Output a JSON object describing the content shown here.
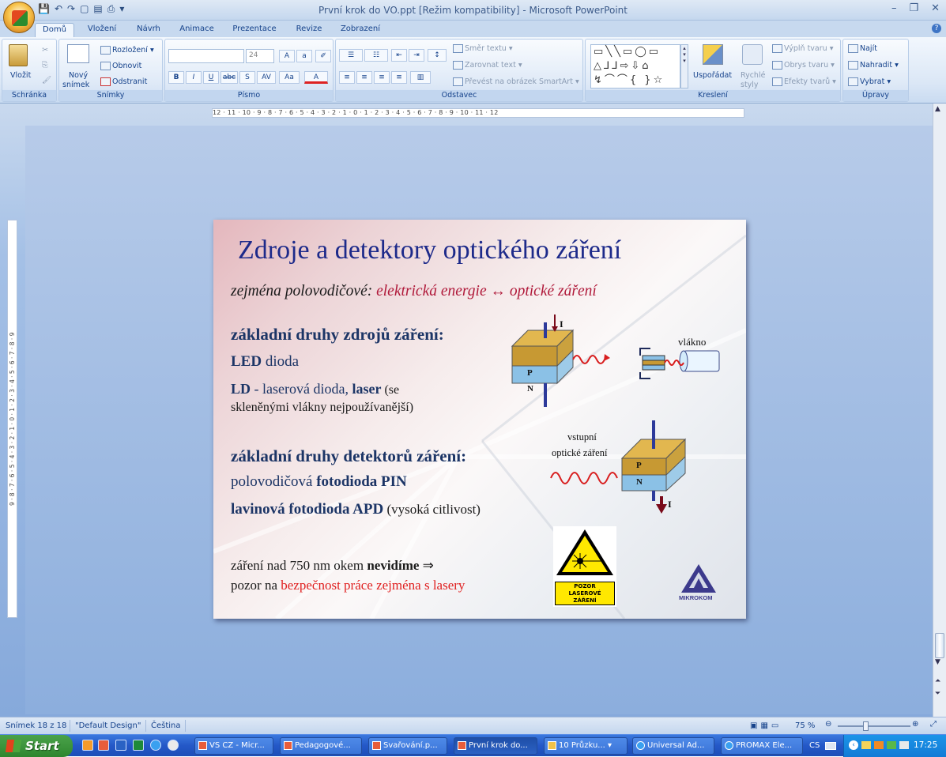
{
  "window": {
    "title": "První krok do VO.ppt [Režim kompatibility] - Microsoft PowerPoint"
  },
  "tabs": [
    "Domů",
    "Vložení",
    "Návrh",
    "Animace",
    "Prezentace",
    "Revize",
    "Zobrazení"
  ],
  "ribbon": {
    "schranka": {
      "label": "Schránka",
      "paste": "Vložit"
    },
    "snimky": {
      "label": "Snímky",
      "new_slide": "Nový",
      "new_slide2": "snímek",
      "layout": "Rozložení",
      "reset": "Obnovit",
      "delete": "Odstranit"
    },
    "pismo": {
      "label": "Písmo",
      "font_size": "24"
    },
    "odstavec": {
      "label": "Odstavec",
      "text_direction": "Směr textu",
      "align_text": "Zarovnat text",
      "smartart": "Převést na obrázek SmartArt"
    },
    "kresleni": {
      "label": "Kreslení",
      "arrange": "Uspořádat",
      "quick_styles": "Rychlé",
      "quick_styles2": "styly",
      "fill": "Výplň tvaru",
      "outline": "Obrys tvaru",
      "effects": "Efekty tvarů"
    },
    "upravy": {
      "label": "Úpravy",
      "find": "Najít",
      "replace": "Nahradit",
      "select": "Vybrat"
    }
  },
  "rulers": {
    "horizontal": "12 · 11 · 10 · 9 · 8 · 7 · 6 · 5 · 4 · 3 · 2 · 1 · 0 · 1 · 2 · 3 · 4 · 5 · 6 · 7 · 8 · 9 · 10 · 11 · 12",
    "vertical": "9 · 8 · 7 · 6 · 5 · 4 · 3 · 2 · 1 · 0 · 1 · 2 · 3 · 4 · 5 · 6 · 7 · 8 · 9"
  },
  "slide": {
    "title": "Zdroje a detektory  optického záření",
    "subtitle_prefix": "zejména polovodičové: ",
    "subtitle_red": "elektrická energie ↔ optické záření",
    "sources_heading": "základní druhy  zdrojů záření:",
    "led_bold": "LED",
    "led_rest": " dioda",
    "ld_bold": "LD",
    "ld_rest": " - laserová dioda, ",
    "ld_laser": "laser",
    "ld_paren": " (se",
    "ld_line2": "skleněnými vlákny nejpoužívanější)",
    "detectors_heading": "základní druhy  detektorů záření:",
    "pin_prefix": "polovodičová ",
    "pin_bold": "fotodioda PIN",
    "apd_bold": "lavinová fotodioda APD",
    "apd_rest": " (vysoká citlivost)",
    "warning_line1_a": "záření nad 750 nm okem ",
    "warning_line1_b": "nevidíme",
    "warning_line1_c": " ⇒",
    "warning_line2_a": "pozor na ",
    "warning_line2_b": "bezpečnost práce zejména s lasery",
    "diagram": {
      "current": "I",
      "p": "P",
      "n": "N",
      "fiber": "vlákno",
      "input1": "vstupní",
      "input2": "optické záření"
    },
    "sign": {
      "line1": "POZOR",
      "line2": "LASEROVÉ",
      "line3": "ZÁŘENÍ"
    },
    "logo": "MIKROKOM"
  },
  "status": {
    "slide_info": "Snímek 18 z 18",
    "design": "\"Default Design\"",
    "language": "Čeština",
    "zoom": "75 %"
  },
  "taskbar": {
    "start": "Start",
    "tasks": [
      "VS CZ - Micr...",
      "Pedagogové...",
      "Svařování.p...",
      "První krok do...",
      "10 Průzku...",
      "Universal Ad...",
      "PROMAX Ele..."
    ],
    "lang": "CS",
    "clock": "17:25"
  }
}
